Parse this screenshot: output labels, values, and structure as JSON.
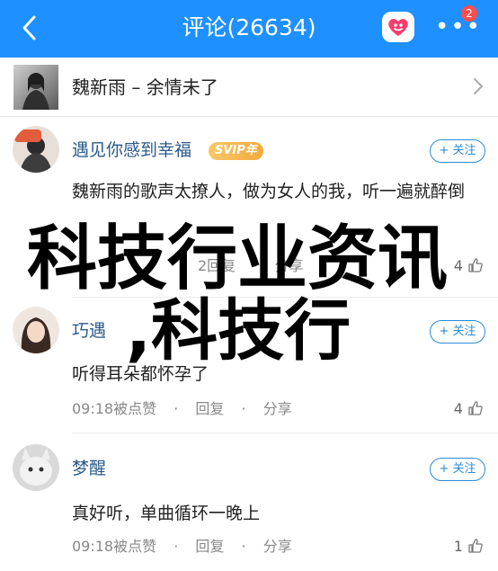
{
  "header": {
    "title": "评论(26634)",
    "badge": "2",
    "color": "#1e90ff"
  },
  "song": {
    "title": "魏新雨 – 余情未了"
  },
  "comments": [
    {
      "username": "遇见你感到幸福",
      "vip_label": "SVIP年",
      "follow_label": "+ 关注",
      "text": "魏新雨的歌声太撩人，做为女人的我，听一遍就醉倒",
      "time": "",
      "like_label": "",
      "reply_label": "2回复",
      "share_label": "分享",
      "likes": "4"
    },
    {
      "username": "巧遇",
      "follow_label": "+ 关注",
      "text": "听得耳朵都怀孕了",
      "time": "09:18被点赞",
      "reply_label": "回复",
      "share_label": "分享",
      "likes": "4"
    },
    {
      "username": "梦醒",
      "follow_label": "+ 关注",
      "text": "真好听，单曲循环一晚上",
      "time": "09:18被点赞",
      "reply_label": "回复",
      "share_label": "分享",
      "likes": "1"
    }
  ],
  "overlay": {
    "line1": "科技行业资讯",
    "line2": ",科技行"
  }
}
